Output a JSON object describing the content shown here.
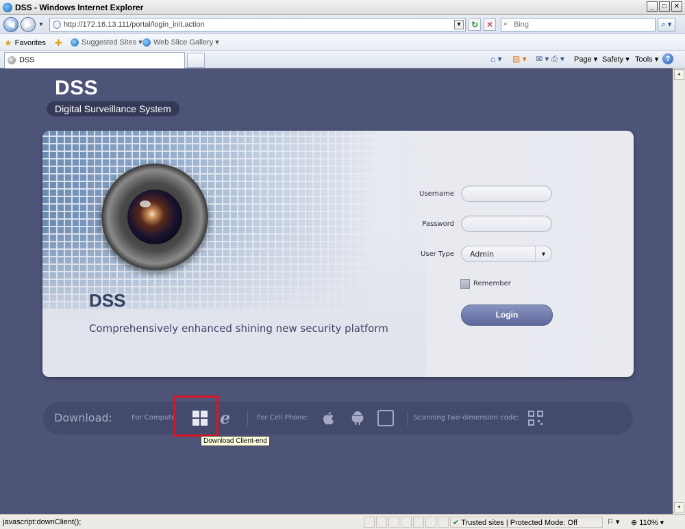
{
  "window": {
    "title": "DSS - Windows Internet Explorer",
    "buttons": [
      "_",
      "□",
      "✕"
    ]
  },
  "address": {
    "url": "http://172.16.13.111/portal/login_init.action",
    "search_placeholder": "Bing"
  },
  "favorites": {
    "label": "Favorites",
    "items": [
      "Suggested Sites ▾",
      "Web Slice Gallery ▾"
    ]
  },
  "tab": {
    "label": "DSS"
  },
  "commands": {
    "page": "Page ▾",
    "safety": "Safety ▾",
    "tools": "Tools ▾"
  },
  "brand": {
    "logo": "DSS",
    "subtitle": "Digital Surveillance System"
  },
  "panel": {
    "title": "DSS",
    "tagline": "Comprehensively enhanced shining new security platform"
  },
  "login": {
    "username_label": "Username",
    "password_label": "Password",
    "usertype_label": "User Type",
    "usertype_value": "Admin",
    "remember_label": "Remember",
    "login_button": "Login"
  },
  "download": {
    "label": "Download:",
    "for_computer": "For Compute",
    "for_cell_phone": "For Cell Phone:",
    "scanning": "Scanning two-dimension code:",
    "tooltip": "Download Client-end"
  },
  "status": {
    "text": "javascript:downClient();",
    "zone": "Trusted sites | Protected Mode: Off",
    "zoom": "110%"
  },
  "colors": {
    "page_bg": "#4d5478",
    "panel_bg": "#e7e9f0",
    "highlight": "#e0141e",
    "login_button": "#6b75a8"
  }
}
